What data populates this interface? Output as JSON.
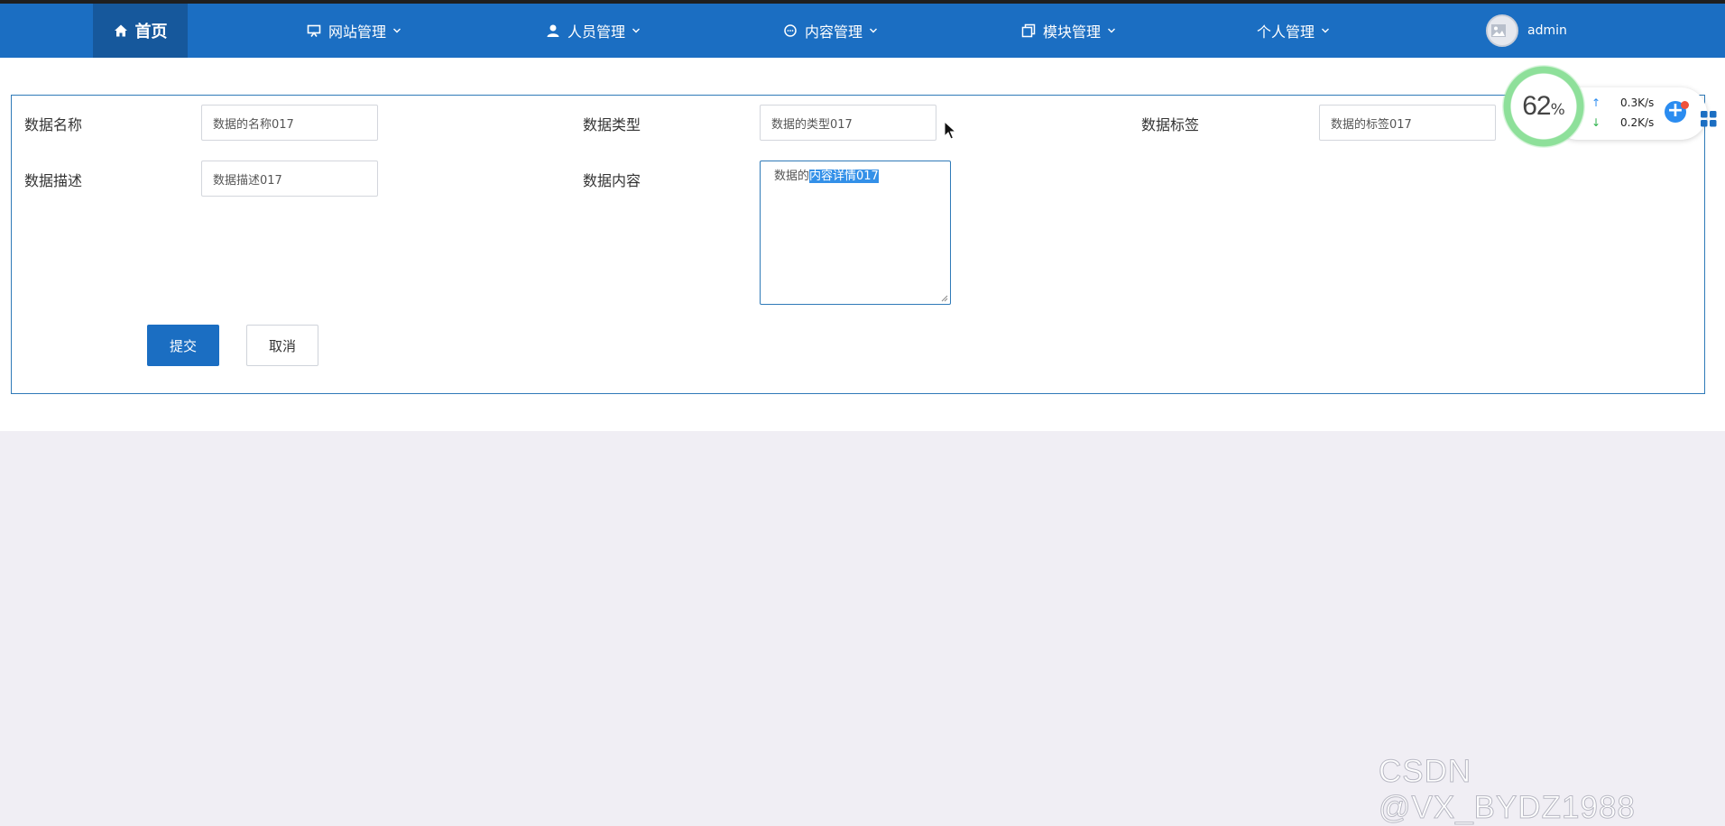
{
  "nav": {
    "home": "首页",
    "items": [
      {
        "label": "网站管理",
        "icon": "monitor-icon"
      },
      {
        "label": "人员管理",
        "icon": "user-icon"
      },
      {
        "label": "内容管理",
        "icon": "chat-icon"
      },
      {
        "label": "模块管理",
        "icon": "copy-icon"
      },
      {
        "label": "个人管理",
        "icon": ""
      }
    ],
    "user": "admin"
  },
  "form": {
    "name_label": "数据名称",
    "name_value": "数据的名称017",
    "type_label": "数据类型",
    "type_value": "数据的类型017",
    "tag_label": "数据标签",
    "tag_value": "数据的标签017",
    "desc_label": "数据描述",
    "desc_value": "数据描述017",
    "content_label": "数据内容",
    "content_prefix": "数据的",
    "content_selected": "内容详情017",
    "submit": "提交",
    "cancel": "取消"
  },
  "widget": {
    "percent": "62",
    "percent_sign": "%",
    "upload": "0.3K/s",
    "download": "0.2K/s",
    "ring_color": "#8ee09a"
  },
  "watermark": "CSDN @VX_BYDZ1988",
  "colors": {
    "nav": "#1b6ec2",
    "nav_active": "#16589c",
    "page_bg": "#f0eef4"
  }
}
